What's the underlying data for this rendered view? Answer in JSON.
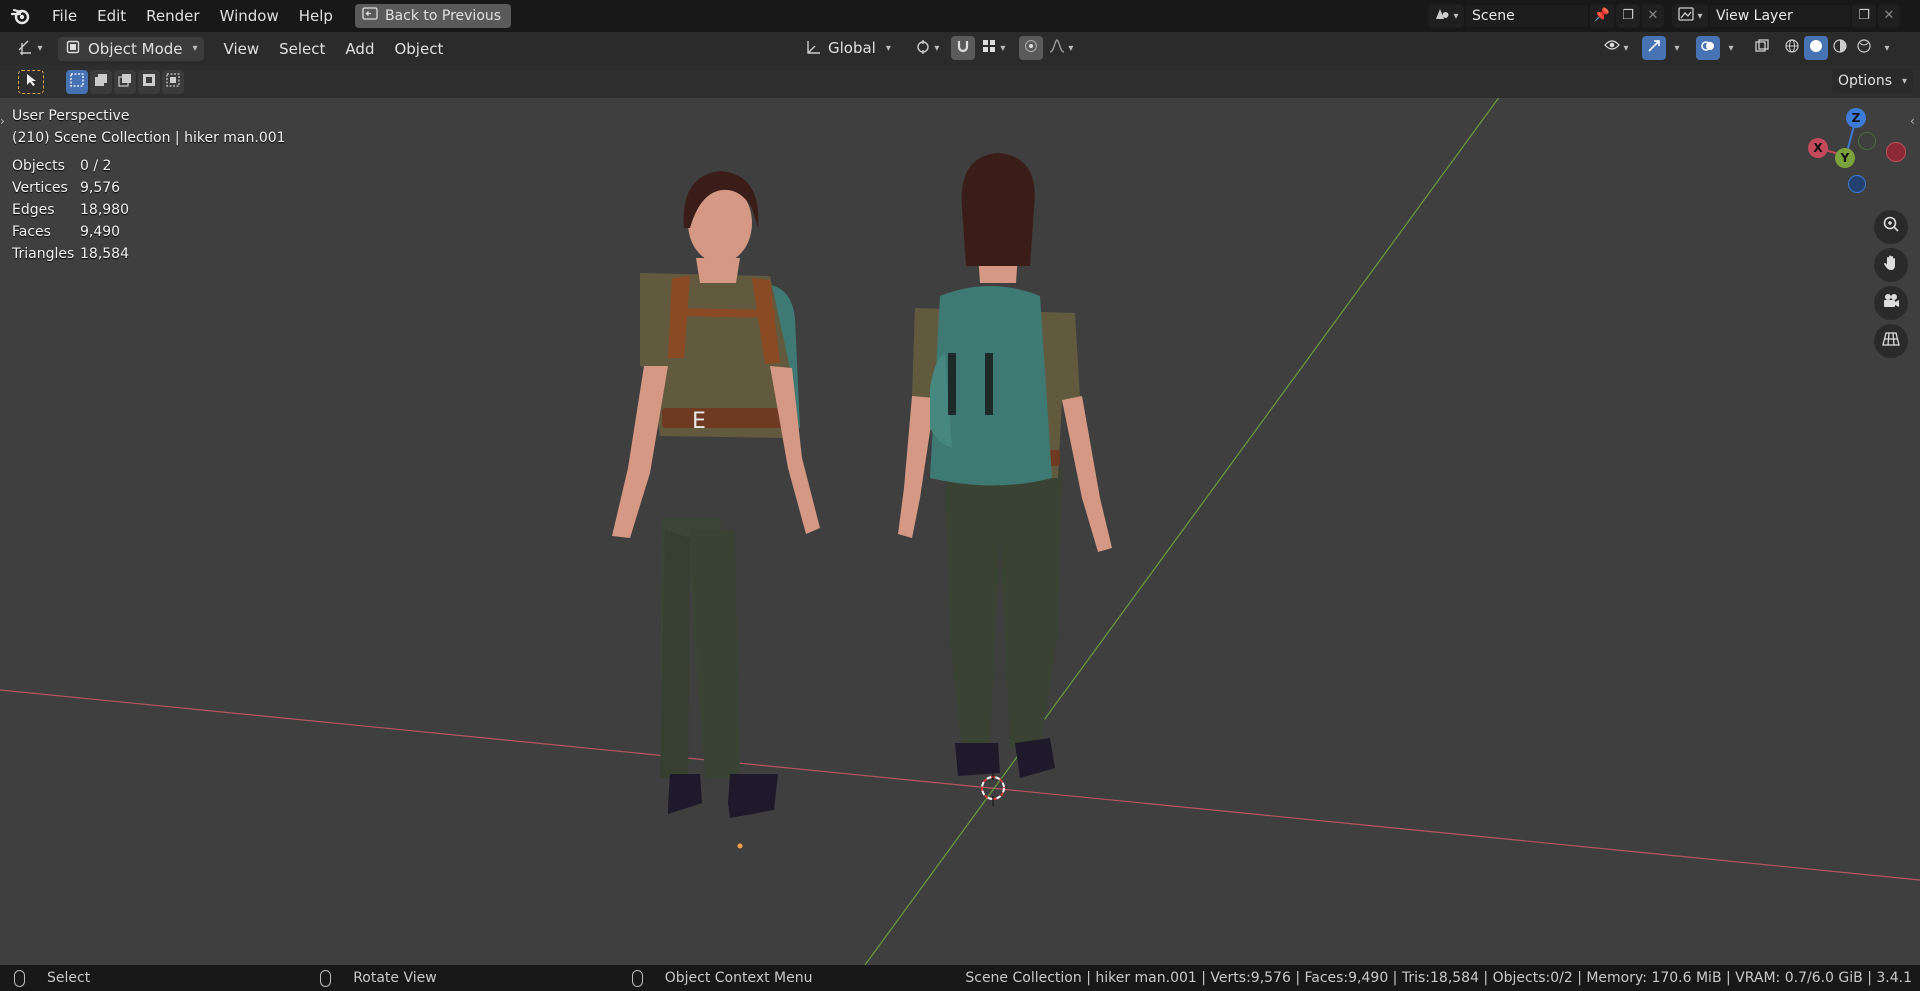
{
  "topbar": {
    "menus": [
      "File",
      "Edit",
      "Render",
      "Window",
      "Help"
    ],
    "back_button": "Back to Previous",
    "scene_name": "Scene",
    "view_layer_name": "View Layer"
  },
  "header": {
    "mode": "Object Mode",
    "menus": [
      "View",
      "Select",
      "Add",
      "Object"
    ],
    "transform_orientation": "Global"
  },
  "toolrow": {
    "options_label": "Options"
  },
  "viewport": {
    "view_name": "User Perspective",
    "collection_info": "(210) Scene Collection | hiker man.001",
    "stats": [
      {
        "label": "Objects",
        "value": "0 / 2"
      },
      {
        "label": "Vertices",
        "value": "9,576"
      },
      {
        "label": "Edges",
        "value": "18,980"
      },
      {
        "label": "Faces",
        "value": "9,490"
      },
      {
        "label": "Triangles",
        "value": "18,584"
      }
    ],
    "gizmo": {
      "x": "X",
      "y": "Y",
      "z": "Z"
    }
  },
  "statusbar": {
    "left_click": "Select",
    "middle_click": "Rotate View",
    "right_click": "Object Context Menu",
    "info": "Scene Collection | hiker man.001 | Verts:9,576 | Faces:9,490 | Tris:18,584 | Objects:0/2 | Memory: 170.6 MiB | VRAM: 0.7/6.0 GiB | 3.4.1"
  },
  "colors": {
    "x_axis": "#c34a5a",
    "y_axis": "#7ca33b",
    "z_axis": "#3d7ad6",
    "accent": "#4772b3"
  }
}
